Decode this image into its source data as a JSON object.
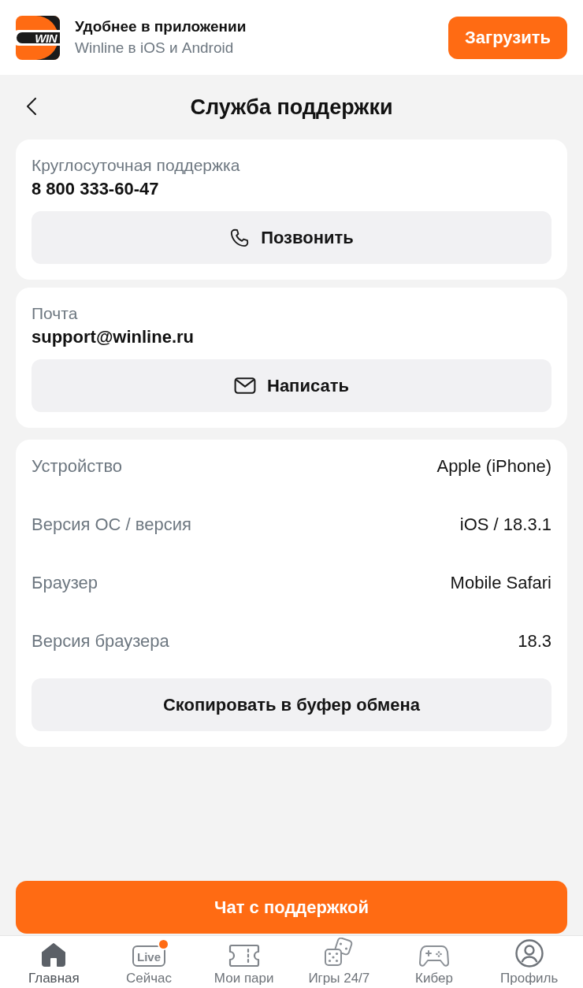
{
  "app_banner": {
    "logo_text": "WIN",
    "title": "Удобнее в приложении",
    "subtitle": "Winline в iOS и Android",
    "button": "Загрузить"
  },
  "header": {
    "title": "Служба поддержки"
  },
  "contacts": [
    {
      "kind": "phone",
      "label": "Круглосуточная поддержка",
      "value": "8 800 333-60-47",
      "button": "Позвонить"
    },
    {
      "kind": "mail",
      "label": "Почта",
      "value": "support@winline.ru",
      "button": "Написать"
    }
  ],
  "device_info": {
    "rows": [
      {
        "label": "Устройство",
        "value": "Apple (iPhone)"
      },
      {
        "label": "Версия ОС / версия",
        "value": "iOS / 18.3.1"
      },
      {
        "label": "Браузер",
        "value": "Mobile Safari"
      },
      {
        "label": "Версия браузера",
        "value": "18.3"
      }
    ],
    "button": "Скопировать в буфер обмена"
  },
  "chat_button": "Чат с поддержкой",
  "bottom_nav": [
    {
      "kind": "home",
      "label": "Главная",
      "selected": true,
      "notification": false
    },
    {
      "kind": "live",
      "label": "Сейчас",
      "icon_text": "Live",
      "selected": false,
      "notification": true
    },
    {
      "kind": "ticket",
      "label": "Мои пари",
      "selected": false,
      "notification": false
    },
    {
      "kind": "dice",
      "label": "Игры 24/7",
      "selected": false,
      "notification": false
    },
    {
      "kind": "gamepad",
      "label": "Кибер",
      "selected": false,
      "notification": false
    },
    {
      "kind": "profile",
      "label": "Профиль",
      "selected": false,
      "notification": false
    }
  ]
}
